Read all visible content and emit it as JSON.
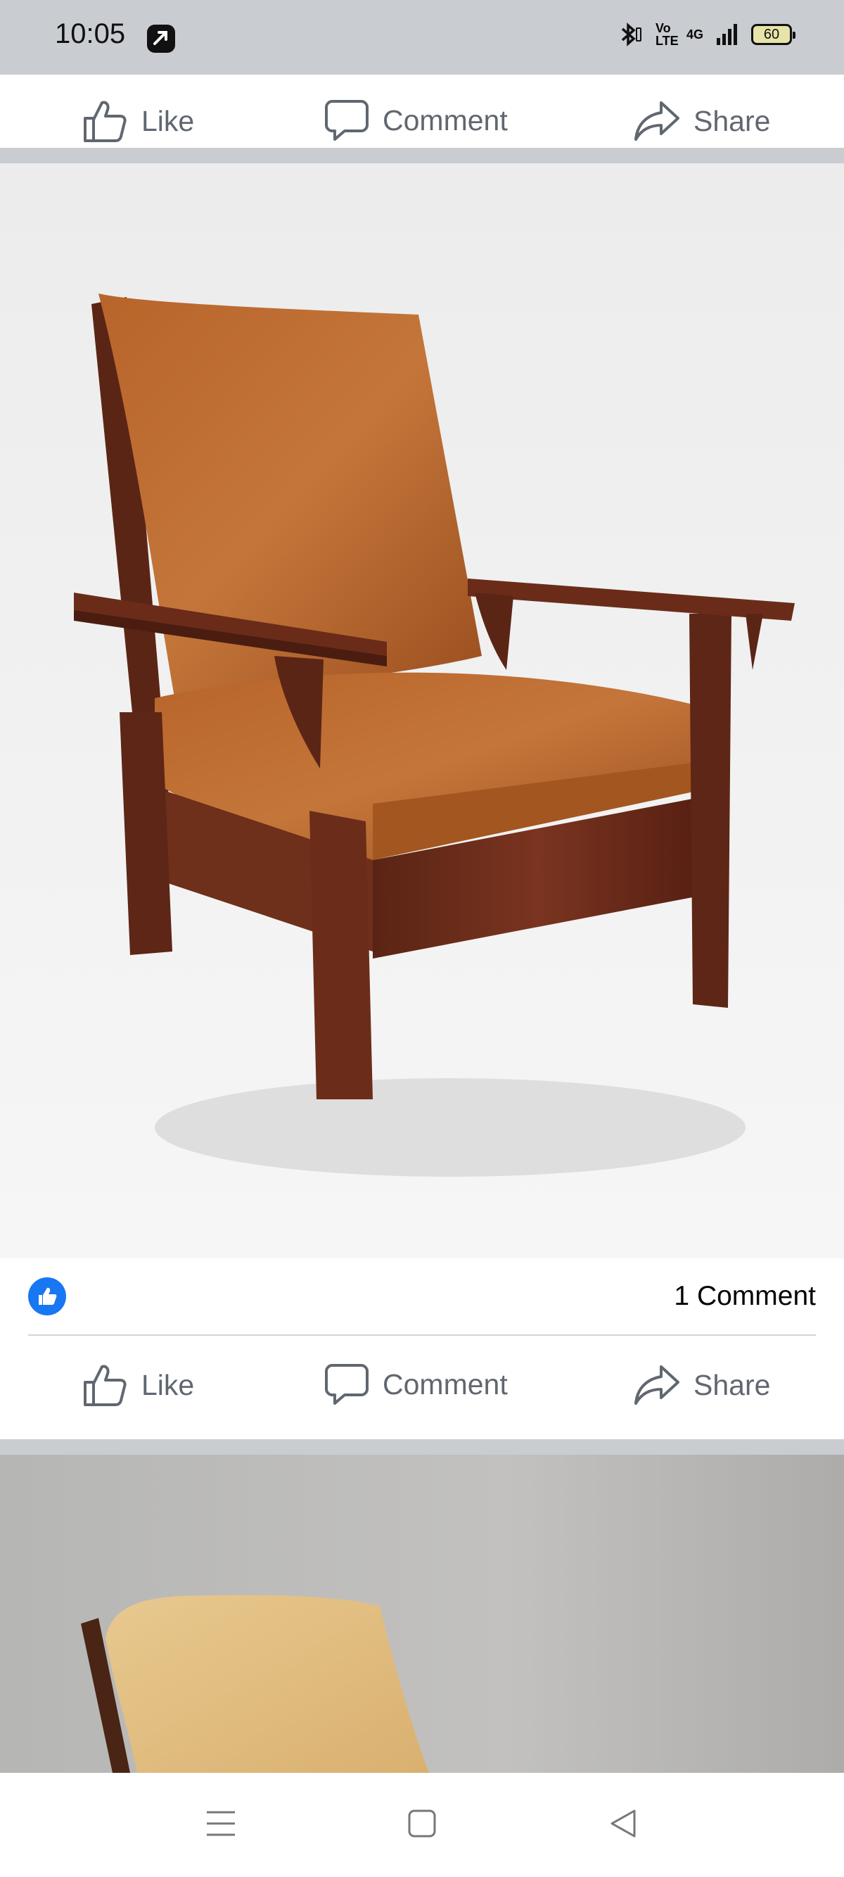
{
  "status_bar": {
    "time": "10:05",
    "signal": "4G",
    "volte": "Vo LTE",
    "battery": "60",
    "icons": [
      "app-icon",
      "bluetooth-icon",
      "volte-icon",
      "signal-icon",
      "battery-icon"
    ]
  },
  "top_actions": {
    "like": "Like",
    "comment": "Comment",
    "share": "Share"
  },
  "post": {
    "comment_count": "1 Comment",
    "actions": {
      "like": "Like",
      "comment": "Comment",
      "share": "Share"
    }
  },
  "nav": {
    "icons": [
      "menu-icon",
      "home-icon",
      "back-icon"
    ]
  },
  "colors": {
    "facebook_blue": "#1877f2",
    "action_gray": "#606770",
    "gap_gray": "#c9ccd1"
  }
}
